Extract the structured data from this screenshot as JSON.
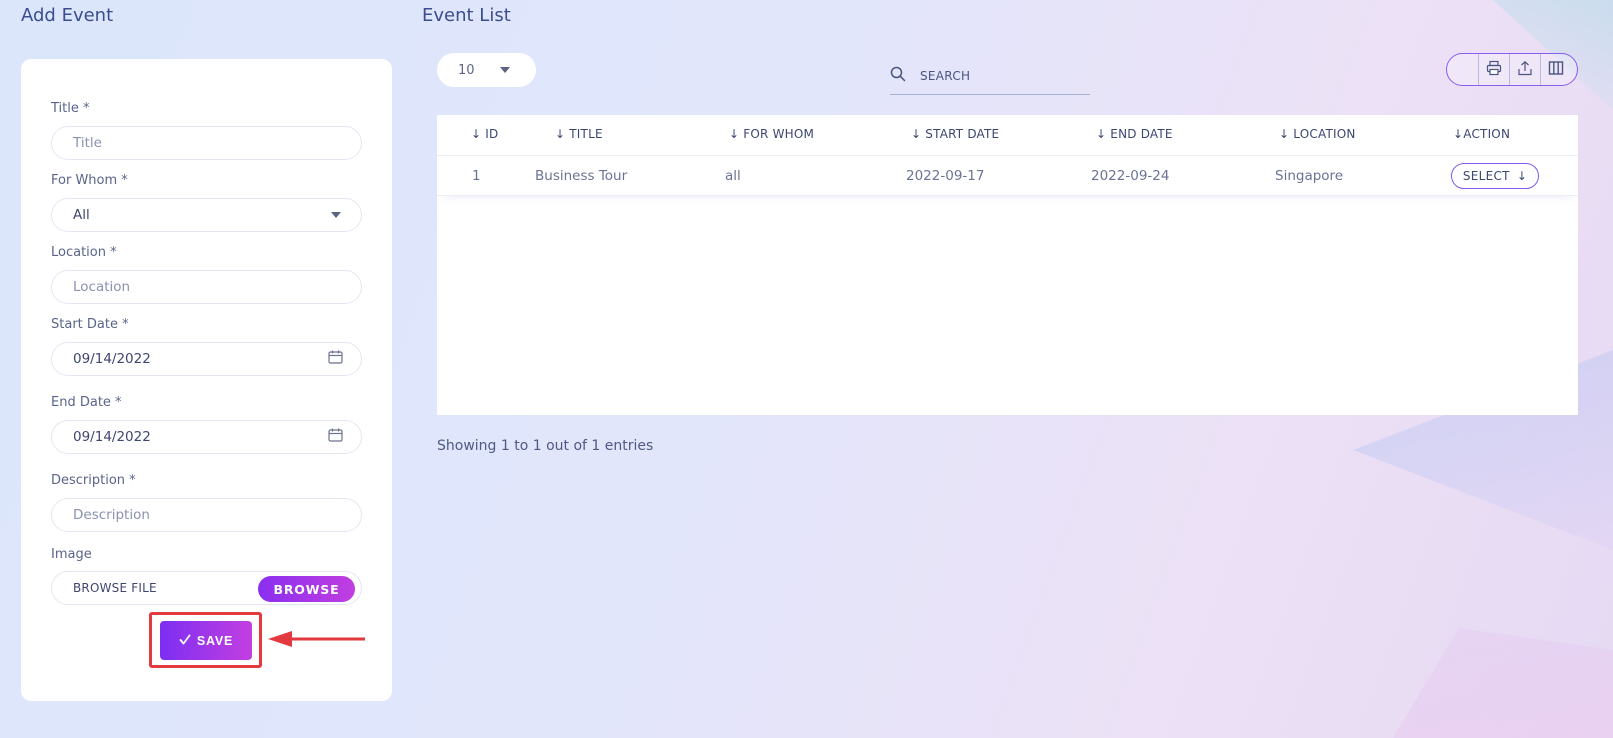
{
  "add_event": {
    "title": "Add Event",
    "fields": {
      "title": {
        "label": "Title *",
        "placeholder": "Title"
      },
      "for_whom": {
        "label": "For Whom *",
        "value": "All"
      },
      "location": {
        "label": "Location *",
        "placeholder": "Location"
      },
      "start_date": {
        "label": "Start Date *",
        "value": "09/14/2022"
      },
      "end_date": {
        "label": "End Date *",
        "value": "09/14/2022"
      },
      "description": {
        "label": "Description *",
        "placeholder": "Description"
      },
      "image": {
        "label": "Image",
        "browse_text": "BROWSE FILE",
        "browse_button": "BROWSE"
      }
    },
    "save_label": "SAVE"
  },
  "event_list": {
    "title": "Event List",
    "page_size": "10",
    "search_placeholder": "SEARCH",
    "columns": [
      "ID",
      "TITLE",
      "FOR WHOM",
      "START DATE",
      "END DATE",
      "LOCATION",
      "ACTION"
    ],
    "rows": [
      {
        "id": "1",
        "title": "Business Tour",
        "for_whom": "all",
        "start_date": "2022-09-17",
        "end_date": "2022-09-24",
        "location": "Singapore",
        "action": "SELECT"
      }
    ],
    "footer": "Showing 1 to 1 out of 1 entries"
  },
  "icons": {
    "search": "search-icon",
    "calendar": "calendar-icon",
    "print": "print-icon",
    "export": "export-icon",
    "columns": "columns-icon",
    "sort": "arrow-down-icon",
    "check": "check-icon"
  },
  "colors": {
    "accent_start": "#7d2ef2",
    "accent_end": "#c23fe0",
    "highlight": "#e23a3f"
  }
}
